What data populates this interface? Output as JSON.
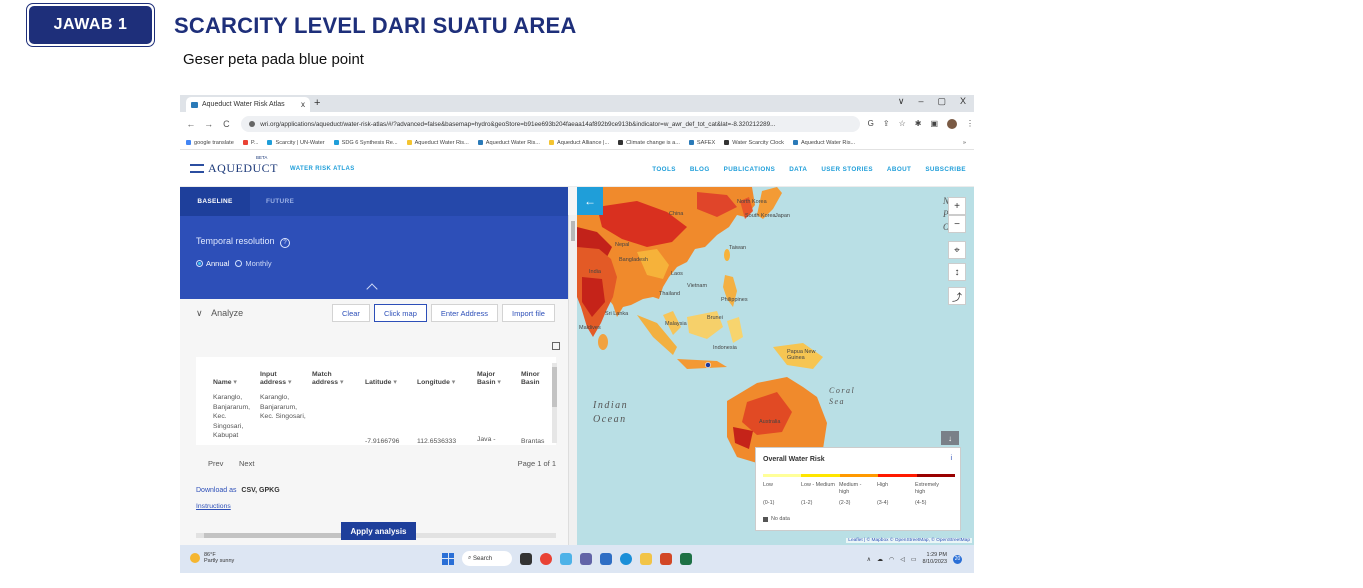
{
  "slide": {
    "badge": "JAWAB 1",
    "title": "SCARCITY LEVEL DARI SUATU AREA",
    "subtitle": "Geser peta pada blue point"
  },
  "browser": {
    "tab_title": "Aqueduct Water Risk Atlas",
    "new_tab": "+",
    "tab_close": "x",
    "window_controls": [
      "∨",
      "–",
      "▢",
      "X"
    ],
    "nav": [
      "←",
      "→",
      "C"
    ],
    "url": "wri.org/applications/aqueduct/water-risk-atlas/#/?advanced=false&basemap=hydro&geoStore=b91ee693b204faeaa14af892b9ce913b&indicator=w_awr_def_tot_cat&lat=-8.320212289...",
    "bookmarks": [
      {
        "label": "google translate",
        "color": "#4285f4"
      },
      {
        "label": "P...",
        "color": "#ea4335"
      },
      {
        "label": "Scarcity | UN-Water",
        "color": "#1f9ed9"
      },
      {
        "label": "SDG 6 Synthesis Re...",
        "color": "#1f9ed9"
      },
      {
        "label": "Aqueduct Water Ris...",
        "color": "#f4c430"
      },
      {
        "label": "Aqueduct Water Ris...",
        "color": "#2a7ab8"
      },
      {
        "label": "Aqueduct Alliance |...",
        "color": "#f4c430"
      },
      {
        "label": "Climate change is a...",
        "color": "#333333"
      },
      {
        "label": "SAFEX",
        "color": "#2a7ab8"
      },
      {
        "label": "Water Scarcity Clock",
        "color": "#333333"
      },
      {
        "label": "Aqueduct Water Ris...",
        "color": "#2a7ab8"
      }
    ],
    "bookmarks_more": "»"
  },
  "app": {
    "logo_word": "AQUEDUCT",
    "logo_beta": "BETA",
    "logo_sub": "WATER RISK ATLAS",
    "nav": [
      "TOOLS",
      "BLOG",
      "PUBLICATIONS",
      "DATA",
      "USER STORIES",
      "ABOUT",
      "SUBSCRIBE"
    ]
  },
  "panel": {
    "tabs": [
      "BASELINE",
      "FUTURE"
    ],
    "temporal_label": "Temporal resolution",
    "temporal_help": "?",
    "temporal_options": [
      "Annual",
      "Monthly"
    ],
    "temporal_selected": "Annual",
    "analyze_label": "Analyze",
    "analyze_chevron": "∨",
    "buttons": [
      "Clear",
      "Click map",
      "Enter Address",
      "Import file"
    ],
    "active_button": "Click map",
    "table": {
      "columns": [
        {
          "l1": "",
          "l2": "Name"
        },
        {
          "l1": "Input",
          "l2": "address"
        },
        {
          "l1": "Match",
          "l2": "address"
        },
        {
          "l1": "",
          "l2": "Latitude"
        },
        {
          "l1": "",
          "l2": "Longitude"
        },
        {
          "l1": "Major",
          "l2": "Basin"
        },
        {
          "l1": "Minor",
          "l2": "Basin"
        }
      ],
      "row": {
        "name": "Karanglo, Banjararum, Kec. Singosari, Kabupat",
        "input": "Karanglo, Banjararum, Kec. Singosari,",
        "lat": "-7.9166796",
        "lon": "112.6536333",
        "major": "Java -",
        "minor": "Brantas"
      }
    },
    "pager": {
      "prev": "Prev",
      "next": "Next",
      "page": "Page 1 of 1"
    },
    "download_label": "Download as",
    "download_formats": "CSV,  GPKG",
    "instructions": "Instructions",
    "apply": "Apply analysis"
  },
  "map": {
    "labels": [
      {
        "t": "North Korea"
      },
      {
        "t": "South Korea"
      },
      {
        "t": "Japan"
      },
      {
        "t": "China"
      },
      {
        "t": "Nepal"
      },
      {
        "t": "Bangladesh"
      },
      {
        "t": "India"
      },
      {
        "t": "Laos"
      },
      {
        "t": "Vietnam"
      },
      {
        "t": "Thailand"
      },
      {
        "t": "Philippines"
      },
      {
        "t": "Sri Lanka"
      },
      {
        "t": "Maldives"
      },
      {
        "t": "Malaysia"
      },
      {
        "t": "Brunei"
      },
      {
        "t": "Indonesia"
      },
      {
        "t": "Papua New Guinea"
      },
      {
        "t": "Australia"
      },
      {
        "t": "Taiwan"
      }
    ],
    "ocean_indian": [
      "Indian",
      "Ocean"
    ],
    "sea_coral": [
      "Coral",
      "Sea"
    ],
    "ocean_pacific_fragment": [
      "N",
      "Pa",
      "O"
    ],
    "back_arrow": "←",
    "controls": [
      "+",
      "−",
      "⌖",
      "↕",
      "⤴"
    ],
    "download_icon": "↓",
    "legend": {
      "title": "Overall Water Risk",
      "info": "i",
      "categories": [
        "Low",
        "Low - Medium",
        "Medium - high",
        "High",
        "Extremely high"
      ],
      "ranges": [
        "(0-1)",
        "(1-2)",
        "(2-3)",
        "(3-4)",
        "(4-5)"
      ],
      "colors": [
        "#ffff99",
        "#ffe600",
        "#ff9900",
        "#ff1900",
        "#990000"
      ],
      "no_data": "No data"
    },
    "attribution": "Leaflet | © Mapbox © OpenStreetMap, © OpenStreetMap"
  },
  "taskbar": {
    "temp": "86°F",
    "weather": "Partly sunny",
    "search": "Search",
    "time": "1:29 PM",
    "date": "8/10/2023",
    "notif": "20"
  }
}
